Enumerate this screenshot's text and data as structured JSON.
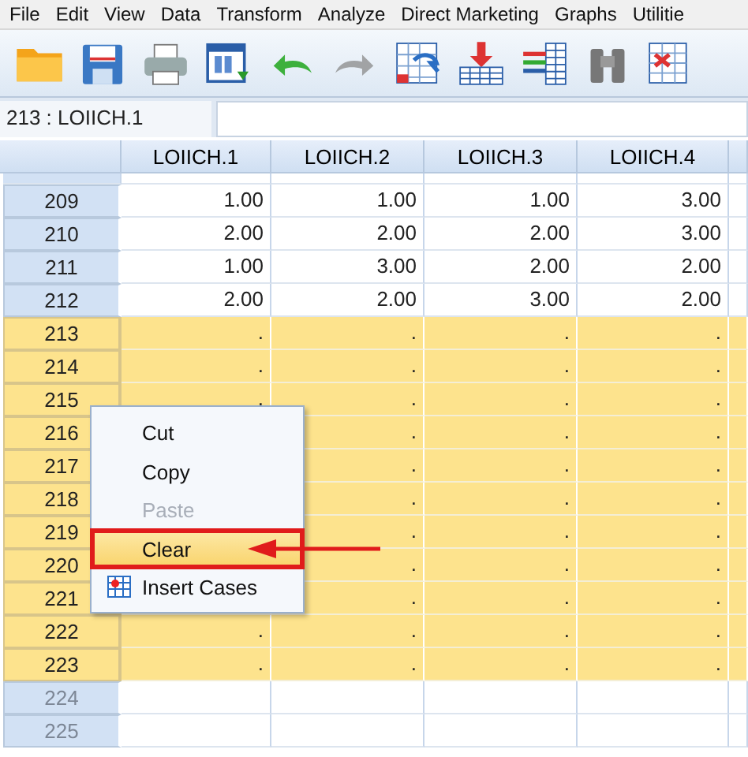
{
  "menu_bar": {
    "items": [
      "File",
      "Edit",
      "View",
      "Data",
      "Transform",
      "Analyze",
      "Direct Marketing",
      "Graphs",
      "Utilitie"
    ]
  },
  "toolbar": {
    "buttons": [
      {
        "disabled": false
      },
      {
        "disabled": false
      },
      {
        "disabled": false
      },
      {
        "disabled": false
      },
      {
        "disabled": false
      },
      {
        "disabled": true
      },
      {
        "disabled": false
      },
      {
        "disabled": false
      },
      {
        "disabled": false
      },
      {
        "disabled": false
      },
      {
        "disabled": false
      }
    ]
  },
  "cell_bar": {
    "cell_reference": "213 : LOIICH.1"
  },
  "grid": {
    "columns": [
      "LOIICH.1",
      "LOIICH.2",
      "LOIICH.3",
      "LOIICH.4"
    ],
    "rows": [
      {
        "number": "209",
        "selected": false,
        "empty": false,
        "cells": [
          "1.00",
          "1.00",
          "1.00",
          "3.00"
        ]
      },
      {
        "number": "210",
        "selected": false,
        "empty": false,
        "cells": [
          "2.00",
          "2.00",
          "2.00",
          "3.00"
        ]
      },
      {
        "number": "211",
        "selected": false,
        "empty": false,
        "cells": [
          "1.00",
          "3.00",
          "2.00",
          "2.00"
        ]
      },
      {
        "number": "212",
        "selected": false,
        "empty": false,
        "cells": [
          "2.00",
          "2.00",
          "3.00",
          "2.00"
        ]
      },
      {
        "number": "213",
        "selected": true,
        "empty": false,
        "cells": [
          ".",
          ".",
          ".",
          "."
        ]
      },
      {
        "number": "214",
        "selected": true,
        "empty": false,
        "cells": [
          ".",
          ".",
          ".",
          "."
        ]
      },
      {
        "number": "215",
        "selected": true,
        "empty": false,
        "cells": [
          ".",
          ".",
          ".",
          "."
        ]
      },
      {
        "number": "216",
        "selected": true,
        "empty": false,
        "cells": [
          null,
          ".",
          ".",
          "."
        ]
      },
      {
        "number": "217",
        "selected": true,
        "empty": false,
        "cells": [
          null,
          ".",
          ".",
          "."
        ]
      },
      {
        "number": "218",
        "selected": true,
        "empty": false,
        "cells": [
          null,
          ".",
          ".",
          "."
        ]
      },
      {
        "number": "219",
        "selected": true,
        "empty": false,
        "cells": [
          null,
          ".",
          ".",
          "."
        ]
      },
      {
        "number": "220",
        "selected": true,
        "empty": false,
        "cells": [
          null,
          ".",
          ".",
          "."
        ]
      },
      {
        "number": "221",
        "selected": true,
        "empty": false,
        "cells": [
          null,
          ".",
          ".",
          "."
        ]
      },
      {
        "number": "222",
        "selected": true,
        "empty": false,
        "cells": [
          ".",
          ".",
          ".",
          "."
        ]
      },
      {
        "number": "223",
        "selected": true,
        "empty": false,
        "cells": [
          ".",
          ".",
          ".",
          "."
        ]
      },
      {
        "number": "224",
        "selected": false,
        "empty": true
      },
      {
        "number": "225",
        "selected": false,
        "empty": true
      }
    ]
  },
  "context_menu": {
    "items": [
      {
        "label": "Cut",
        "disabled": false,
        "selected": false,
        "callout": false
      },
      {
        "label": "Copy",
        "disabled": false,
        "selected": false,
        "callout": false
      },
      {
        "label": "Paste",
        "disabled": true,
        "selected": false,
        "callout": false
      },
      {
        "label": "Clear",
        "disabled": false,
        "selected": true,
        "callout": true
      },
      {
        "label": "Insert Cases",
        "disabled": false,
        "selected": false,
        "callout": false,
        "kind": "icon"
      }
    ]
  }
}
